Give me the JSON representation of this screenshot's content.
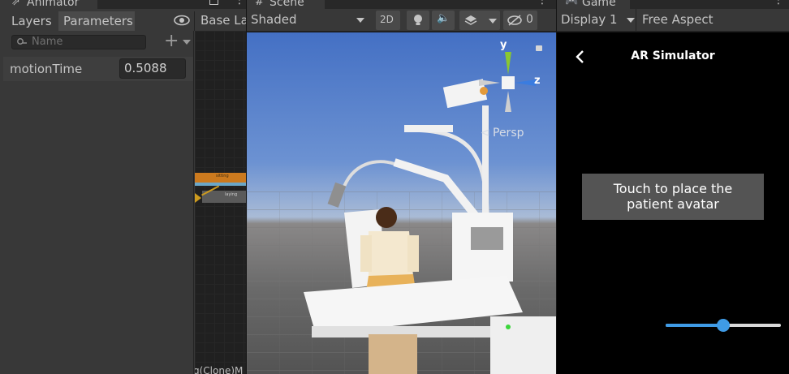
{
  "animator": {
    "tab_title": "Animator",
    "tabs": [
      "Layers",
      "Parameters"
    ],
    "search_placeholder": "Name",
    "layer_label": "Base La",
    "parameter": {
      "name": "motionTime",
      "value": "0.5088"
    },
    "graph_bottom_label": "g(Clone)M",
    "state_labels": [
      "sitting",
      "laying"
    ]
  },
  "scene": {
    "tab_title": "Scene",
    "shading_mode": "Shaded",
    "mode_2d": "2D",
    "hidden_count": "0",
    "gizmo": {
      "y_axis": "y",
      "z_axis": "z",
      "projection": "Persp"
    }
  },
  "game": {
    "tab_title": "Game",
    "display": "Display 1",
    "aspect": "Free Aspect",
    "app_title": "AR Simulator",
    "prompt_line1": "Touch to place the",
    "prompt_line2": "patient avatar",
    "slider_value": 0.5
  },
  "colors": {
    "panel": "#383838",
    "header": "#282828",
    "gizmo_y": "#8ac731",
    "gizmo_z": "#3a7ce0",
    "slider_accent": "#3f9be6",
    "state_orange": "#cc7a1e"
  }
}
